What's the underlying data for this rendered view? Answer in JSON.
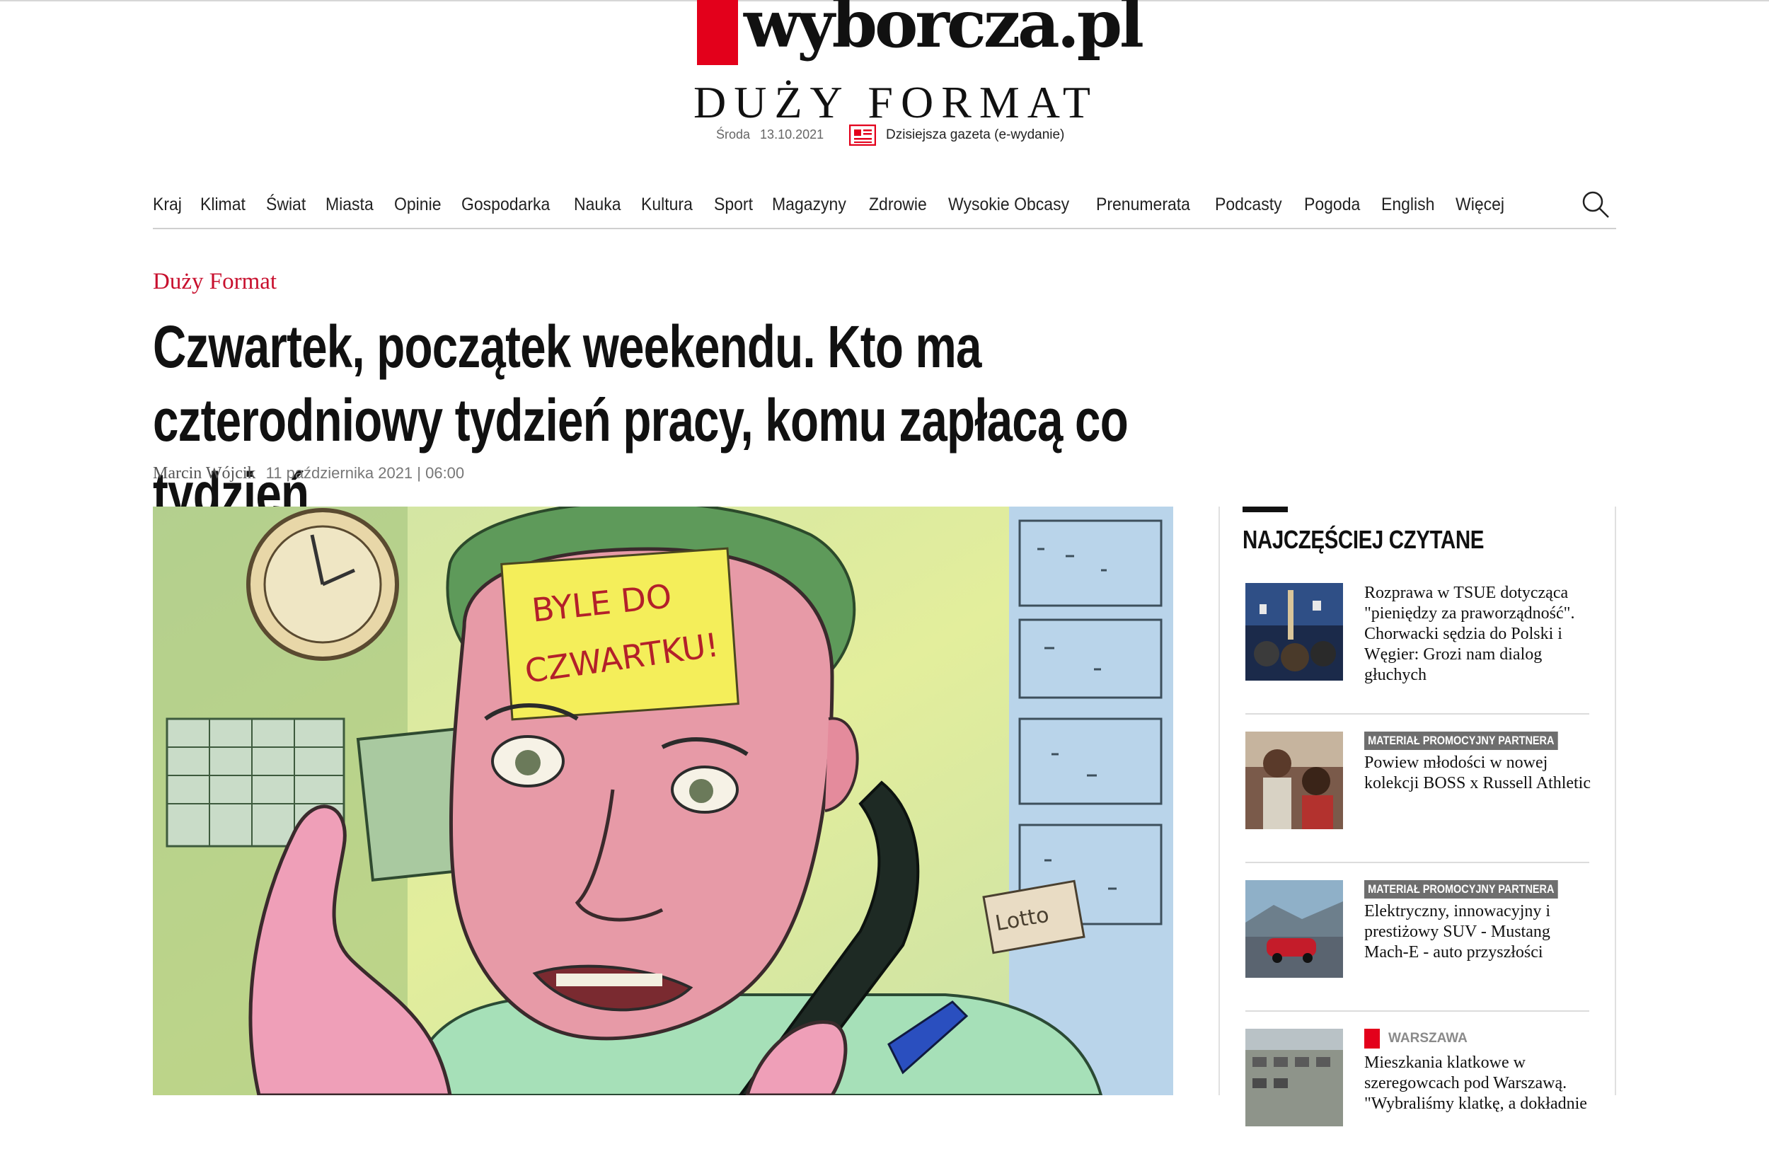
{
  "masthead": {
    "logo_text": "wyborcza.pl",
    "section_title": "DUŻY FORMAT",
    "day": "Środa",
    "date": "13.10.2021",
    "edition_label": "Dzisiejsza gazeta (e-wydanie)"
  },
  "nav": {
    "items": [
      "Kraj",
      "Klimat",
      "Świat",
      "Miasta",
      "Opinie",
      "Gospodarka",
      "Nauka",
      "Kultura",
      "Sport",
      "Magazyny",
      "Zdrowie",
      "Wysokie Obcasy",
      "Prenumerata",
      "Podcasty",
      "Pogoda",
      "English",
      "Więcej"
    ]
  },
  "article": {
    "kicker": "Duży Format",
    "headline": "Czwartek, początek weekendu. Kto ma czterodniowy tydzień pracy, komu zapłacą co tydzień",
    "author": "Marcin Wójcik",
    "published": "11 października 2021 | 06:00",
    "illustration_note": "BYLE DO CZWARTKU!",
    "illustration_ticket": "Lotto"
  },
  "sidebar": {
    "heading": "NAJCZĘŚCIEJ CZYTANE",
    "items": [
      {
        "title": "Rozprawa w TSUE dotycząca \"pieniędzy za praworządność\". Chorwacki sędzia do Polski i Węgier: Grozi nam dialog głuchych"
      },
      {
        "badge": "MATERIAŁ PROMOCYJNY PARTNERA",
        "title": "Powiew młodości w nowej kolekcji BOSS x Russell Athletic"
      },
      {
        "badge": "MATERIAŁ PROMOCYJNY PARTNERA",
        "title": "Elektryczny, innowacyjny i prestiżowy SUV - Mustang Mach-E - auto przyszłości"
      },
      {
        "category": "WARSZAWA",
        "title": "Mieszkania klatkowe w szeregowcach pod Warszawą. \"Wybraliśmy klatkę, a dokładnie"
      }
    ]
  },
  "colors": {
    "brand_red": "#e3001b",
    "kicker_red": "#c8102e",
    "badge_gray": "#6e6e6e"
  }
}
